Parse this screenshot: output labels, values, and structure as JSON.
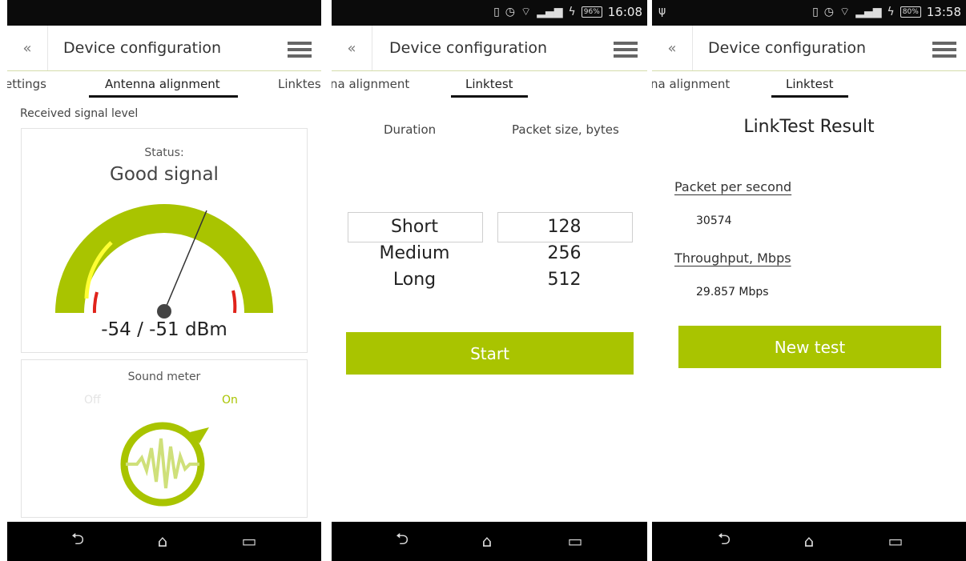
{
  "colors": {
    "accent": "#a9c400",
    "statusbar": "#0b0b0b",
    "navbar": "#000000",
    "gauge_red": "#e0231b",
    "gauge_yellow": "#ffff33"
  },
  "panel1": {
    "title": "Device configuration",
    "tabs": [
      "ettings",
      "Antenna alignment",
      "Linktes"
    ],
    "section_label": "Received signal level",
    "status_label": "Status:",
    "status_value": "Good signal",
    "reading": "-54 / -51 dBm",
    "sound_meter": {
      "label": "Sound meter",
      "off": "Off",
      "on": "On"
    }
  },
  "panel2": {
    "status": {
      "battery": "96%",
      "time": "16:08"
    },
    "title": "Device configuration",
    "tabs": [
      "na alignment",
      "Linktest"
    ],
    "col_duration": "Duration",
    "col_packet": "Packet size, bytes",
    "durations": [
      "Short",
      "Medium",
      "Long"
    ],
    "sizes": [
      "128",
      "256",
      "512"
    ],
    "start": "Start"
  },
  "panel3": {
    "status": {
      "battery": "80%",
      "time": "13:58"
    },
    "title": "Device configuration",
    "tabs": [
      "na alignment",
      "Linktest"
    ],
    "result_title": "LinkTest Result",
    "pps_label": "Packet per second",
    "pps_value": "30574",
    "thr_label": "Throughput, Mbps",
    "thr_value": "29.857 Mbps",
    "new_test": "New test"
  },
  "icons": {
    "back": "double-chevron-left-icon",
    "menu": "hamburger-menu-icon",
    "nav_back": "back-arrow-icon",
    "nav_home": "home-icon",
    "nav_recent": "recent-apps-icon"
  }
}
